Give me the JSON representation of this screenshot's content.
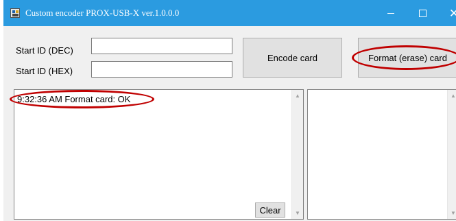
{
  "window": {
    "title": "Custom encoder PROX-USB-X ver.1.0.0.0",
    "icon": "app-icon",
    "titlebar_color": "#2b9be0",
    "controls": {
      "minimize": "minimize-icon",
      "maximize": "maximize-icon",
      "close": "close-icon"
    }
  },
  "form": {
    "start_id_dec_label": "Start ID (DEC)",
    "start_id_dec_value": "",
    "start_id_hex_label": "Start ID (HEX)",
    "start_id_hex_value": "",
    "encode_button": "Encode card",
    "format_button": "Format (erase) card"
  },
  "log": {
    "lines": [
      "9:32:36 AM Format card: OK"
    ],
    "clear_button": "Clear"
  },
  "annotation_color": "#c00000"
}
